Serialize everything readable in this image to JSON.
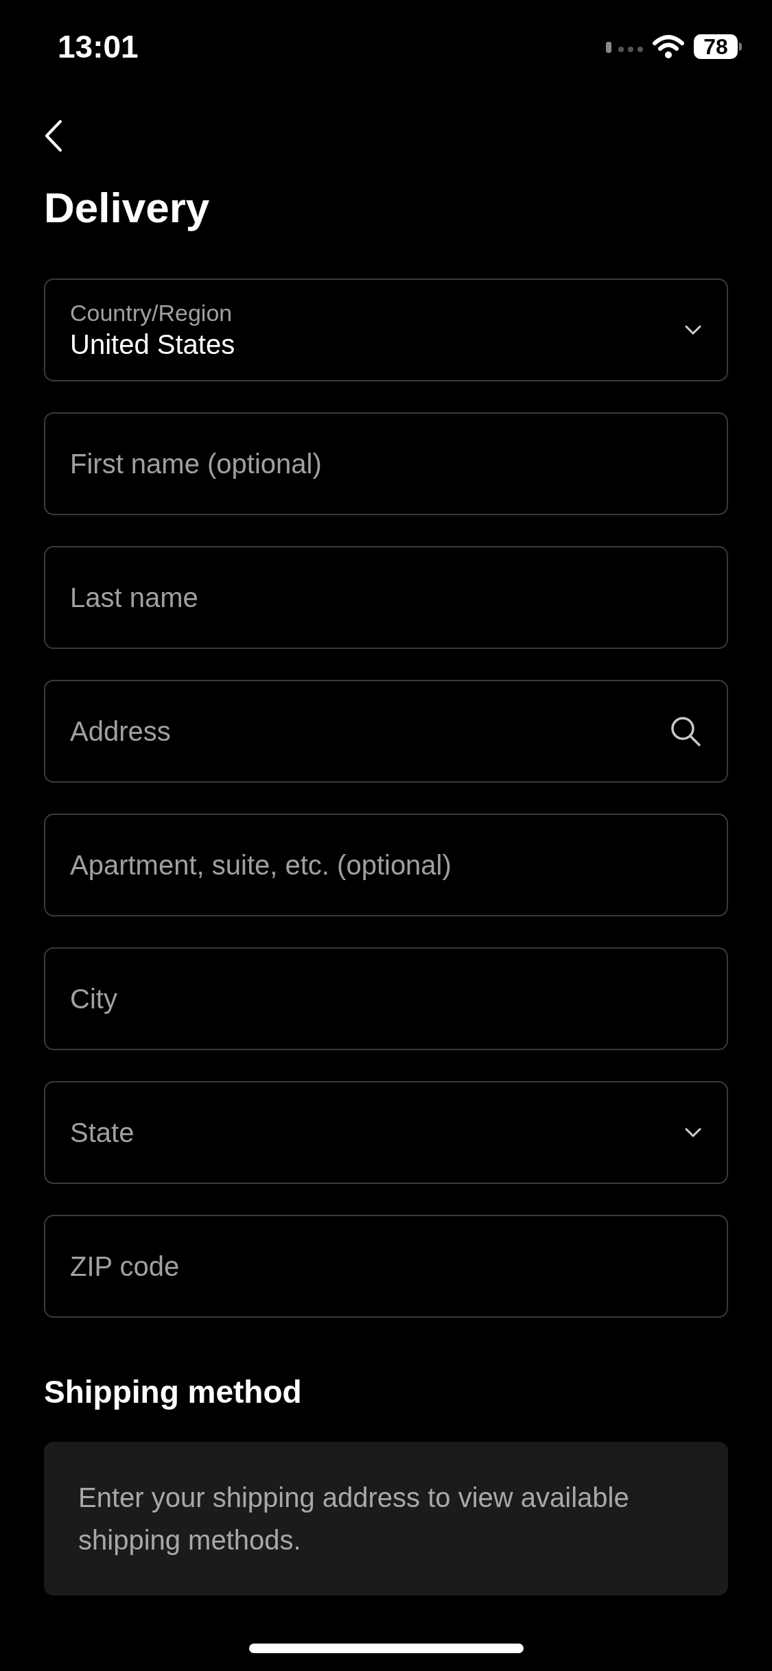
{
  "status_bar": {
    "time": "13:01",
    "battery": "78"
  },
  "title": "Delivery",
  "fields": [
    {
      "kind": "select",
      "label": "Country/Region",
      "value": "United States"
    },
    {
      "kind": "text",
      "placeholder": "First name (optional)"
    },
    {
      "kind": "text",
      "placeholder": "Last name"
    },
    {
      "kind": "search",
      "placeholder": "Address"
    },
    {
      "kind": "text",
      "placeholder": "Apartment, suite, etc. (optional)"
    },
    {
      "kind": "text",
      "placeholder": "City"
    },
    {
      "kind": "select",
      "placeholder": "State"
    },
    {
      "kind": "text",
      "placeholder": "ZIP code"
    }
  ],
  "shipping": {
    "heading": "Shipping method",
    "message": "Enter your shipping address to view available shipping methods."
  }
}
